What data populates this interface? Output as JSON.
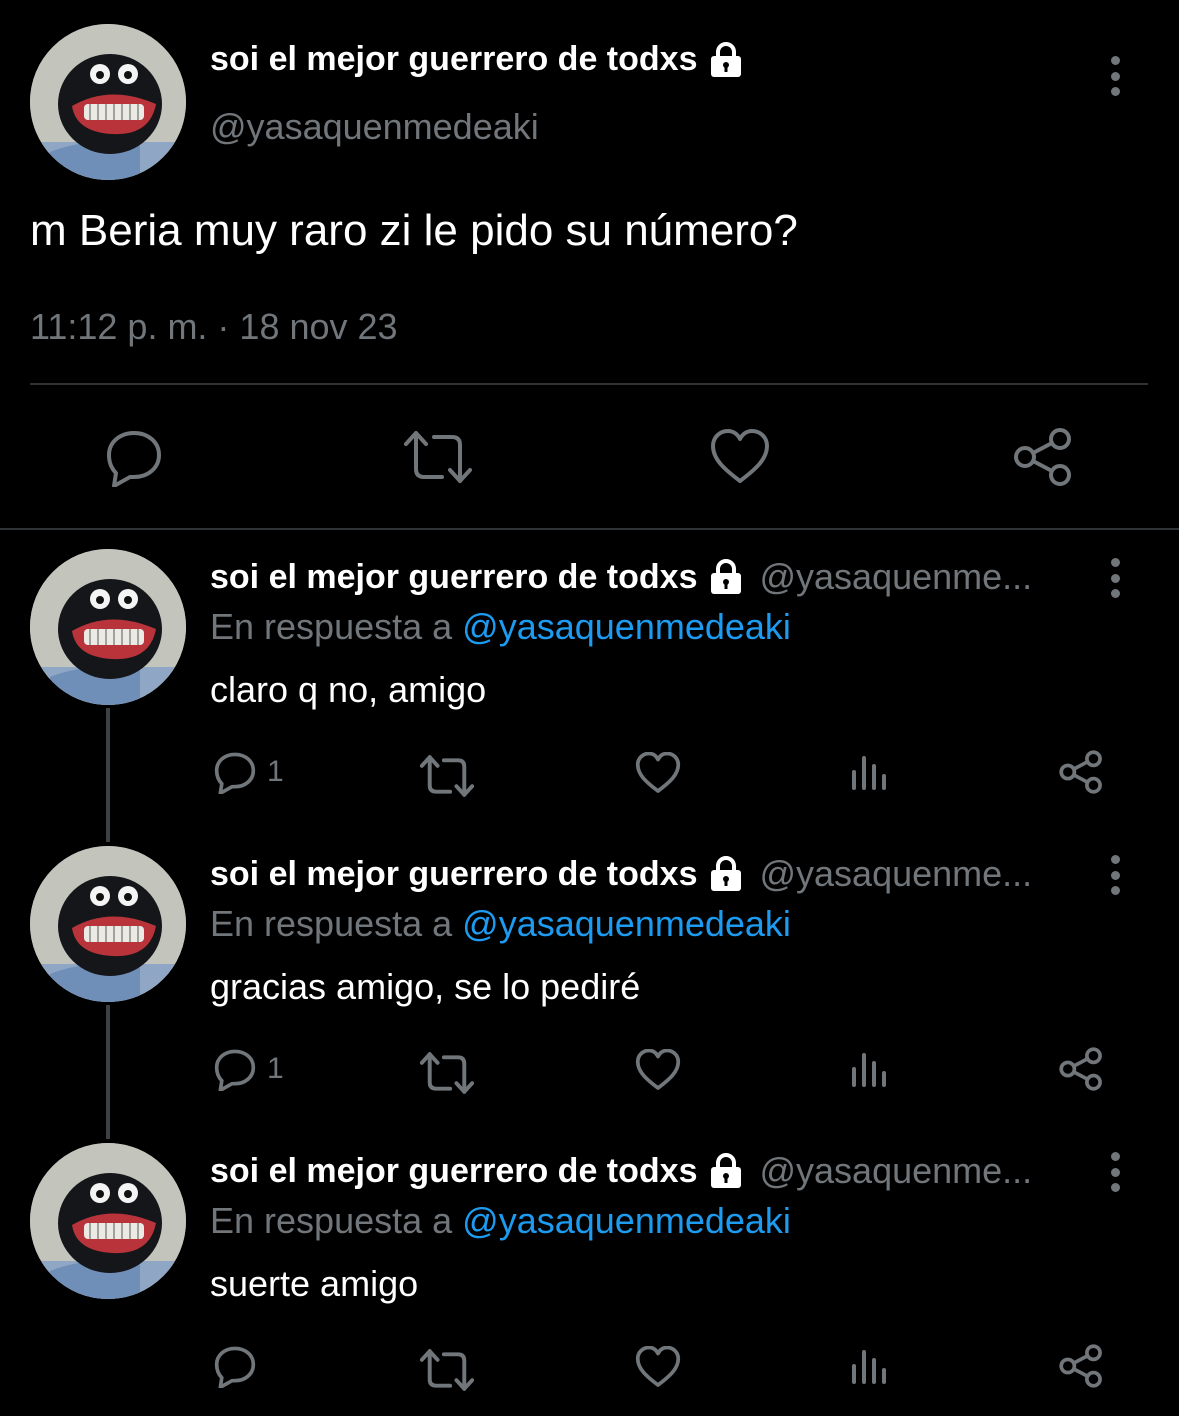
{
  "main_tweet": {
    "display_name": "soi el mejor guerrero de todxs",
    "handle": "@yasaquenmedeaki",
    "text": "m Beria muy raro zi le pido su número?",
    "timestamp": "11:12 p. m. · 18 nov 23",
    "icons": {
      "reply": "reply-icon",
      "retweet": "retweet-icon",
      "like": "heart-icon",
      "share": "share-icon",
      "lock": "lock-icon",
      "more": "more-icon"
    }
  },
  "replies": [
    {
      "display_name": "soi el mejor guerrero de todxs",
      "handle": "@yasaquenme...",
      "reply_prefix": "En respuesta a",
      "reply_mention": "@yasaquenmedeaki",
      "text": "claro q no, amigo",
      "reply_count": "1"
    },
    {
      "display_name": "soi el mejor guerrero de todxs",
      "handle": "@yasaquenme...",
      "reply_prefix": "En respuesta a",
      "reply_mention": "@yasaquenmedeaki",
      "text": "gracias amigo, se lo pediré",
      "reply_count": "1"
    },
    {
      "display_name": "soi el mejor guerrero de todxs",
      "handle": "@yasaquenme...",
      "reply_prefix": "En respuesta a",
      "reply_mention": "@yasaquenmedeaki",
      "text": "suerte amigo",
      "reply_count": ""
    }
  ],
  "colors": {
    "background": "#000000",
    "text_primary": "#ffffff",
    "text_secondary": "#71767b",
    "mention": "#1d9bf0",
    "divider": "#2f3336"
  }
}
